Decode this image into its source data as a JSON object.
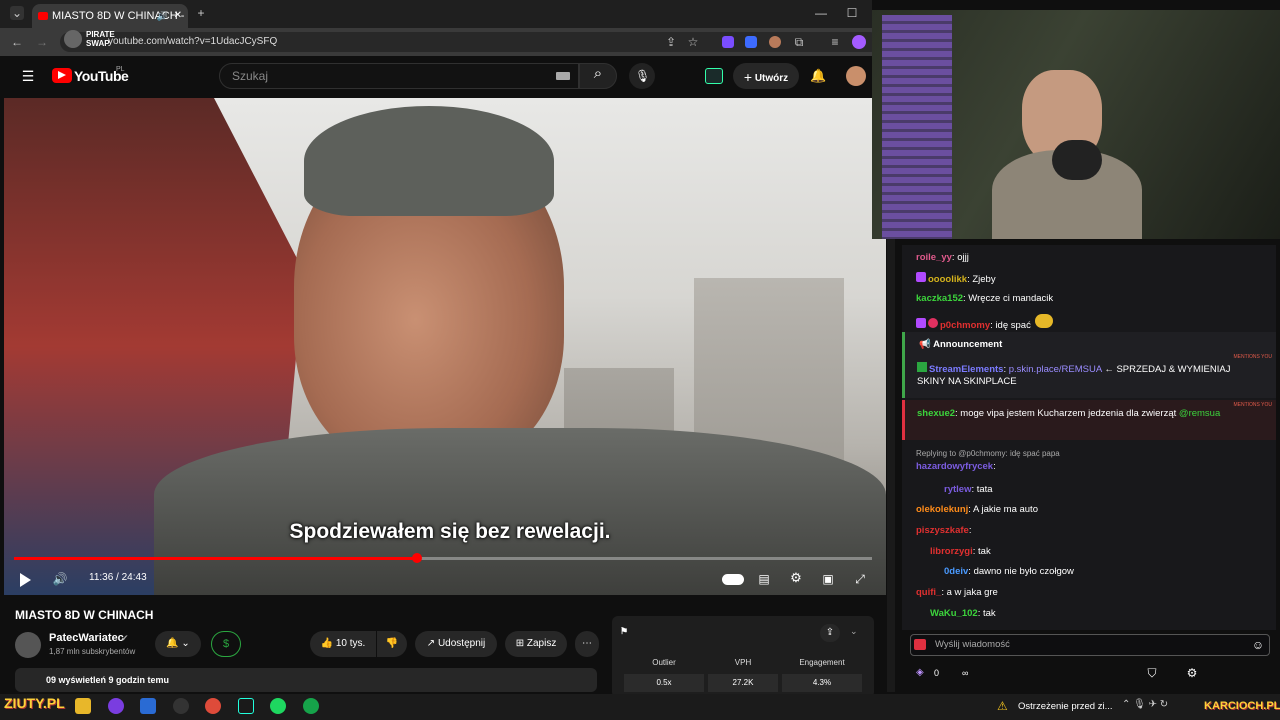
{
  "browser": {
    "tab_title": "MIASTO 8D W CHINACH - ",
    "url": "youtube.com/watch?v=1UdacJCySFQ",
    "ext_badge": "PIRATE SWAP"
  },
  "youtube": {
    "logo": "YouTube",
    "region": "PL",
    "search_placeholder": "Szukaj",
    "create_label": "Utwórz"
  },
  "player": {
    "subtitle": "Spodziewałem się bez rewelacji.",
    "time": "11:36 / 24:43",
    "progress_fraction": 0.47
  },
  "video": {
    "title": "MIASTO 8D W CHINACH",
    "channel": "PatecWariatec",
    "subscribers": "1,87 mln subskrybentów",
    "views": "09 wyświetleń  9 godzin temu",
    "likes": "10 tys.",
    "share": "Udostępnij",
    "save": "Zapisz"
  },
  "stats": {
    "headers": [
      "Outlier",
      "VPH",
      "Engagement"
    ],
    "values": [
      "0.5x",
      "27.2K",
      "4.3%"
    ]
  },
  "chat": {
    "messages": [
      {
        "user": "roile_yy",
        "text": ": ojjj",
        "color": "#e05a8c"
      },
      {
        "user": "oooolikk",
        "text": ": Zjeby",
        "color": "#d4b21c"
      },
      {
        "user": "kaczka152",
        "text": ": Wręcze ci mandacik",
        "color": "#3cd43c"
      },
      {
        "user": "p0chmomy",
        "text": ": idę spać",
        "color": "#e03030"
      }
    ],
    "announcement_title": "Announcement",
    "announcement_user": "StreamElements",
    "announcement_link": "p.skin.place/REMSUA",
    "announcement_text": "← SPRZEDAJ & WYMIENIAJ",
    "announcement_text2": "SKINY NA SKINPLACE",
    "mention_label": "MENTIONS YOU",
    "mention_user": "shexue2",
    "mention_text": ": moge vipa jestem Kucharzem jedzenia dla zwierząt",
    "mention_tag": "@remsua",
    "reply_note": "Replying to @p0chmomy: idę spać papa",
    "messages2": [
      {
        "user": "hazardowyfrycek",
        "text": ":",
        "color": "#7b5ce0"
      },
      {
        "user": "rytlew",
        "text": ": tata",
        "color": "#7b5ce0"
      },
      {
        "user": "olekolekunj",
        "text": ": A jakie ma auto",
        "color": "#ff8c1a"
      },
      {
        "user": "piszyszkafe",
        "text": ":",
        "color": "#e03030"
      },
      {
        "user": "librorzygi",
        "text": ": tak",
        "color": "#e03030"
      },
      {
        "user": "0deiv",
        "text": ": dawno nie było czołgow",
        "color": "#4a9aff"
      },
      {
        "user": "quifi_",
        "text": ": a w jaka gre",
        "color": "#e03030"
      },
      {
        "user": "WaKu_102",
        "text": ": tak",
        "color": "#3cd43c"
      }
    ],
    "input_placeholder": "Wyślij wiadomość",
    "points": "0",
    "points_extra": "∞"
  },
  "taskbar": {
    "notification": "Ostrzeżenie przed zi...",
    "left_brand": "ZIUTY.PL",
    "right_brand": "KARCIOCH.PL"
  },
  "colors": {
    "accent": "#ff0000",
    "twitch": "#9147ff",
    "green": "#2ba640"
  }
}
